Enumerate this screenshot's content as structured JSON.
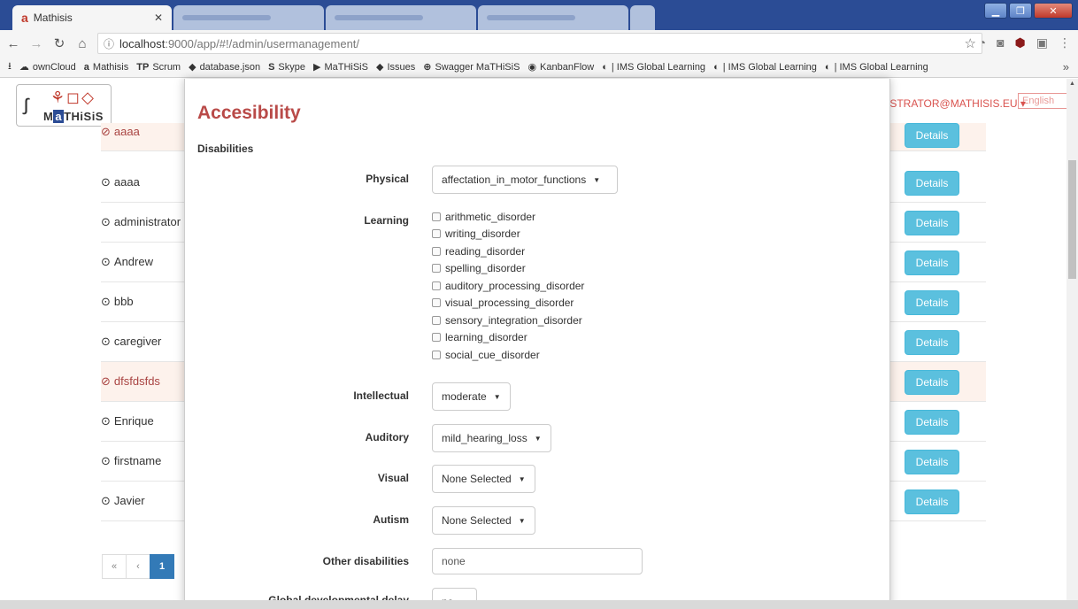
{
  "browser": {
    "active_tab": {
      "title": "Mathisis",
      "favicon": "a"
    },
    "url_host": "localhost",
    "url_path": ":9000/app/#!/admin/usermanagement/",
    "bookmarks": [
      {
        "icon": "☁",
        "label": "ownCloud"
      },
      {
        "icon": "a",
        "label": "Mathisis"
      },
      {
        "icon": "TP",
        "label": "Scrum"
      },
      {
        "icon": "◆",
        "label": "database.json"
      },
      {
        "icon": "S",
        "label": "Skype"
      },
      {
        "icon": "▶",
        "label": "MaTHiSiS"
      },
      {
        "icon": "◆",
        "label": "Issues"
      },
      {
        "icon": "⊕",
        "label": "Swagger MaTHiSiS"
      },
      {
        "icon": "◉",
        "label": "KanbanFlow"
      },
      {
        "icon": "◐",
        "label": "| IMS Global Learning"
      },
      {
        "icon": "◐",
        "label": "| IMS Global Learning"
      },
      {
        "icon": "◐",
        "label": "| IMS Global Learning"
      }
    ],
    "more": "»"
  },
  "header": {
    "logo_text_a": "M",
    "logo_text_b": "a",
    "logo_text_c": "THiSiS",
    "user": "ISTRATOR@MATHISIS.EU ▾",
    "language": "English"
  },
  "users": [
    {
      "name": "aaaa",
      "alert": true
    },
    {
      "name": "aaaa",
      "alert": false
    },
    {
      "name": "administrator",
      "alert": false
    },
    {
      "name": "Andrew",
      "alert": false
    },
    {
      "name": "bbb",
      "alert": false
    },
    {
      "name": "caregiver",
      "alert": false
    },
    {
      "name": "dfsfdsfds",
      "alert": true
    },
    {
      "name": "Enrique",
      "alert": false
    },
    {
      "name": "firstname",
      "alert": false
    },
    {
      "name": "Javier",
      "alert": false
    }
  ],
  "details_label": "Details",
  "pager": {
    "first": "«",
    "prev": "‹",
    "current": "1"
  },
  "modal": {
    "title": "Accesibility",
    "section": "Disabilities",
    "physical": {
      "label": "Physical",
      "value": "affectation_in_motor_functions"
    },
    "learning": {
      "label": "Learning",
      "options": [
        "arithmetic_disorder",
        "writing_disorder",
        "reading_disorder",
        "spelling_disorder",
        "auditory_processing_disorder",
        "visual_processing_disorder",
        "sensory_integration_disorder",
        "learning_disorder",
        "social_cue_disorder"
      ]
    },
    "intellectual": {
      "label": "Intellectual",
      "value": "moderate"
    },
    "auditory": {
      "label": "Auditory",
      "value": "mild_hearing_loss"
    },
    "visual": {
      "label": "Visual",
      "value": "None Selected"
    },
    "autism": {
      "label": "Autism",
      "value": "None Selected"
    },
    "other": {
      "label": "Other disabilities",
      "value": "none"
    },
    "gdd": {
      "label": "Global developmental delay",
      "value": "no"
    }
  }
}
